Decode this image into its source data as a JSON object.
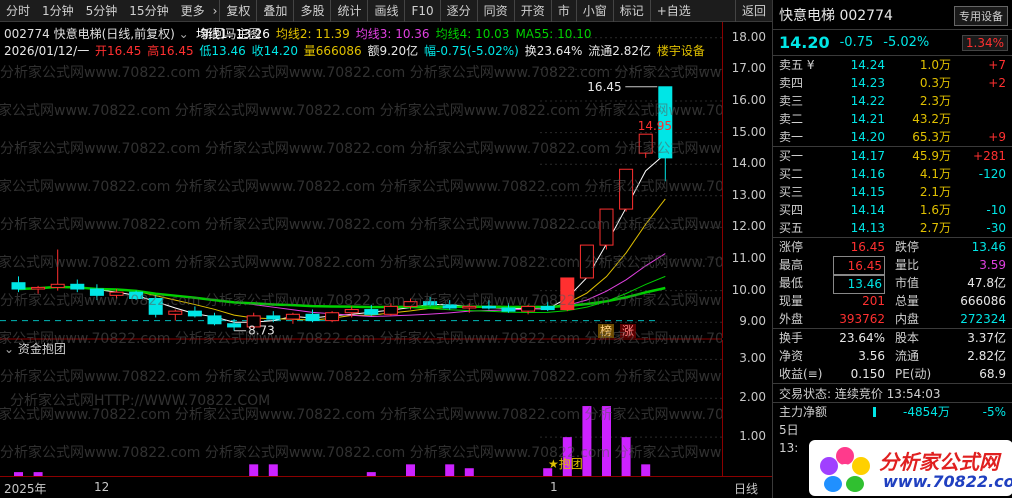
{
  "toolbar": {
    "items": [
      "分时",
      "1分钟",
      "5分钟",
      "15分钟",
      "更多",
      "复权",
      "叠加",
      "多股",
      "统计",
      "画线",
      "F10",
      "逐分",
      "同资",
      "开资",
      "市",
      "小窗",
      "标记",
      "+自选",
      "返回"
    ],
    "more_suffix": "›"
  },
  "stock": {
    "title": "002774 快意电梯(日线,前复权)",
    "indicator_name": "新回马主图"
  },
  "ma_legend": [
    {
      "label": "均线1: 13.26",
      "color": "#ffffff"
    },
    {
      "label": "均线2: 11.39",
      "color": "#e0c000"
    },
    {
      "label": "均线3: 10.36",
      "color": "#e040e0"
    },
    {
      "label": "均线4: 10.03",
      "color": "#00d000"
    },
    {
      "label": "MA55: 10.10",
      "color": "#00d000"
    }
  ],
  "ohlc": {
    "date": "2026/01/12/一",
    "open": "开16.45",
    "high": "高16.45",
    "low": "低13.46",
    "close": "收14.20",
    "vol": "量666086",
    "amount": "额9.20亿",
    "change": "幅-0.75(-5.02%)",
    "turnover": "换23.64%",
    "float": "流通2.82亿",
    "sector": "楼宇设备"
  },
  "main_axis": {
    "ticks": [
      "18.00",
      "17.00",
      "16.00",
      "15.00",
      "14.00",
      "13.00",
      "12.00",
      "11.00",
      "10.00",
      "9.00"
    ]
  },
  "sub_chart": {
    "title": "资金抱团",
    "ticks": [
      "3.00",
      "2.00",
      "1.00"
    ],
    "marker_label": "★抱团"
  },
  "annotations": {
    "high_label": "16.45",
    "prev_high_label": "14.95",
    "low_label": "8.73",
    "tag1": "榜",
    "tag2": "涨"
  },
  "xaxis": {
    "labels": [
      "2025年",
      "12",
      "1"
    ],
    "period": "日线"
  },
  "watermark": "分析家公式网www.70822.com",
  "watermark_alt": "分析家公式网HTTP://WWW.70822.COM",
  "panel": {
    "name": "快意电梯 002774",
    "badge": "专用设备",
    "price": "14.20",
    "change": "-0.75",
    "pct": "-5.02%",
    "turnover_badge": "1.34%",
    "asks": [
      {
        "label": "卖五 ¥",
        "price": "14.24",
        "vol": "1.0万",
        "delta": "+7"
      },
      {
        "label": "卖四",
        "price": "14.23",
        "vol": "0.3万",
        "delta": "+2"
      },
      {
        "label": "卖三",
        "price": "14.22",
        "vol": "2.3万",
        "delta": ""
      },
      {
        "label": "卖二",
        "price": "14.21",
        "vol": "43.2万",
        "delta": ""
      },
      {
        "label": "卖一",
        "price": "14.20",
        "vol": "65.3万",
        "delta": "+9"
      }
    ],
    "bids": [
      {
        "label": "买一",
        "price": "14.17",
        "vol": "45.9万",
        "delta": "+281"
      },
      {
        "label": "买二",
        "price": "14.16",
        "vol": "4.1万",
        "delta": "-120"
      },
      {
        "label": "买三",
        "price": "14.15",
        "vol": "2.1万",
        "delta": ""
      },
      {
        "label": "买四",
        "price": "14.14",
        "vol": "1.6万",
        "delta": "-10"
      },
      {
        "label": "买五",
        "price": "14.13",
        "vol": "2.7万",
        "delta": "-30"
      }
    ],
    "stats1": [
      {
        "k1": "涨停",
        "v1": "16.45",
        "k2": "跌停",
        "v2": "13.46"
      },
      {
        "k1": "最高",
        "v1": "16.45",
        "k2": "量比",
        "v2": "3.59"
      },
      {
        "k1": "最低",
        "v1": "13.46",
        "k2": "市值",
        "v2": "47.8亿"
      },
      {
        "k1": "现量",
        "v1": "201",
        "k2": "总量",
        "v2": "666086"
      },
      {
        "k1": "外盘",
        "v1": "393762",
        "k2": "内盘",
        "v2": "272324"
      }
    ],
    "stats2": [
      {
        "k1": "换手",
        "v1": "23.64%",
        "k2": "股本",
        "v2": "3.37亿"
      },
      {
        "k1": "净资",
        "v1": "3.56",
        "k2": "流通",
        "v2": "2.82亿"
      },
      {
        "k1": "收益(≡)",
        "v1": "0.150",
        "k2": "PE(动)",
        "v2": "68.9"
      }
    ],
    "status": "交易状态: 连续竞价 13:54:03",
    "flow_label": "主力净额",
    "flow_value": "-4854万",
    "flow_pct": "-5%",
    "day_label": "5日",
    "time_label": "13:"
  },
  "logo": {
    "text": "分析家公式网",
    "url": "www.70822.com"
  },
  "colors": {
    "up": "#ff3030",
    "down": "#00e6e6",
    "ma1": "#ffffff",
    "ma2": "#e0c000",
    "ma3": "#e040e0",
    "ma4": "#00d000",
    "subbar": "#cc22ff"
  },
  "chart_data": {
    "type": "candlestick",
    "candles": [
      {
        "o": 10.25,
        "h": 10.45,
        "l": 9.95,
        "c": 10.05
      },
      {
        "o": 10.05,
        "h": 10.15,
        "l": 9.9,
        "c": 10.1
      },
      {
        "o": 10.1,
        "h": 11.3,
        "l": 10.0,
        "c": 10.2
      },
      {
        "o": 10.2,
        "h": 10.35,
        "l": 9.95,
        "c": 10.05
      },
      {
        "o": 10.05,
        "h": 10.2,
        "l": 9.7,
        "c": 9.85
      },
      {
        "o": 9.85,
        "h": 10.05,
        "l": 9.75,
        "c": 9.95
      },
      {
        "o": 9.95,
        "h": 10.0,
        "l": 9.7,
        "c": 9.75
      },
      {
        "o": 9.75,
        "h": 9.85,
        "l": 9.15,
        "c": 9.25
      },
      {
        "o": 9.25,
        "h": 9.4,
        "l": 9.05,
        "c": 9.35
      },
      {
        "o": 9.35,
        "h": 9.5,
        "l": 9.15,
        "c": 9.2
      },
      {
        "o": 9.2,
        "h": 9.3,
        "l": 8.9,
        "c": 8.95
      },
      {
        "o": 8.95,
        "h": 9.1,
        "l": 8.73,
        "c": 8.85
      },
      {
        "o": 8.85,
        "h": 9.3,
        "l": 8.8,
        "c": 9.2
      },
      {
        "o": 9.2,
        "h": 9.35,
        "l": 9.0,
        "c": 9.1
      },
      {
        "o": 9.1,
        "h": 9.3,
        "l": 8.95,
        "c": 9.25
      },
      {
        "o": 9.25,
        "h": 9.4,
        "l": 9.0,
        "c": 9.05
      },
      {
        "o": 9.05,
        "h": 9.35,
        "l": 9.0,
        "c": 9.3
      },
      {
        "o": 9.3,
        "h": 9.5,
        "l": 9.15,
        "c": 9.4
      },
      {
        "o": 9.4,
        "h": 9.55,
        "l": 9.2,
        "c": 9.25
      },
      {
        "o": 9.25,
        "h": 9.6,
        "l": 9.2,
        "c": 9.5
      },
      {
        "o": 9.5,
        "h": 9.75,
        "l": 9.4,
        "c": 9.65
      },
      {
        "o": 9.65,
        "h": 9.8,
        "l": 9.5,
        "c": 9.55
      },
      {
        "o": 9.55,
        "h": 9.7,
        "l": 9.4,
        "c": 9.45
      },
      {
        "o": 9.45,
        "h": 9.6,
        "l": 9.3,
        "c": 9.5
      },
      {
        "o": 9.5,
        "h": 9.7,
        "l": 9.4,
        "c": 9.45
      },
      {
        "o": 9.45,
        "h": 9.6,
        "l": 9.3,
        "c": 9.35
      },
      {
        "o": 9.35,
        "h": 9.55,
        "l": 9.25,
        "c": 9.5
      },
      {
        "o": 9.5,
        "h": 9.65,
        "l": 9.35,
        "c": 9.4
      },
      {
        "o": 9.4,
        "h": 10.4,
        "l": 9.35,
        "c": 10.4
      },
      {
        "o": 10.4,
        "h": 11.44,
        "l": 10.4,
        "c": 11.44
      },
      {
        "o": 11.44,
        "h": 12.58,
        "l": 11.3,
        "c": 12.58
      },
      {
        "o": 12.58,
        "h": 13.84,
        "l": 12.5,
        "c": 13.84
      },
      {
        "o": 14.35,
        "h": 14.95,
        "l": 14.2,
        "c": 14.95
      },
      {
        "o": 16.45,
        "h": 16.45,
        "l": 13.46,
        "c": 14.2
      }
    ],
    "sub_values": [
      0.1,
      0.1,
      0,
      0,
      0,
      0,
      0,
      0,
      0,
      0,
      0,
      0,
      0.3,
      0.3,
      0,
      0,
      0,
      0,
      0.1,
      0,
      0.3,
      0,
      0.3,
      0.2,
      0,
      0,
      0,
      0.2,
      1.0,
      1.8,
      1.8,
      1.0,
      0.3,
      0
    ],
    "ylim": [
      8.5,
      18.5
    ],
    "sub_ylim": [
      0,
      3.5
    ]
  }
}
